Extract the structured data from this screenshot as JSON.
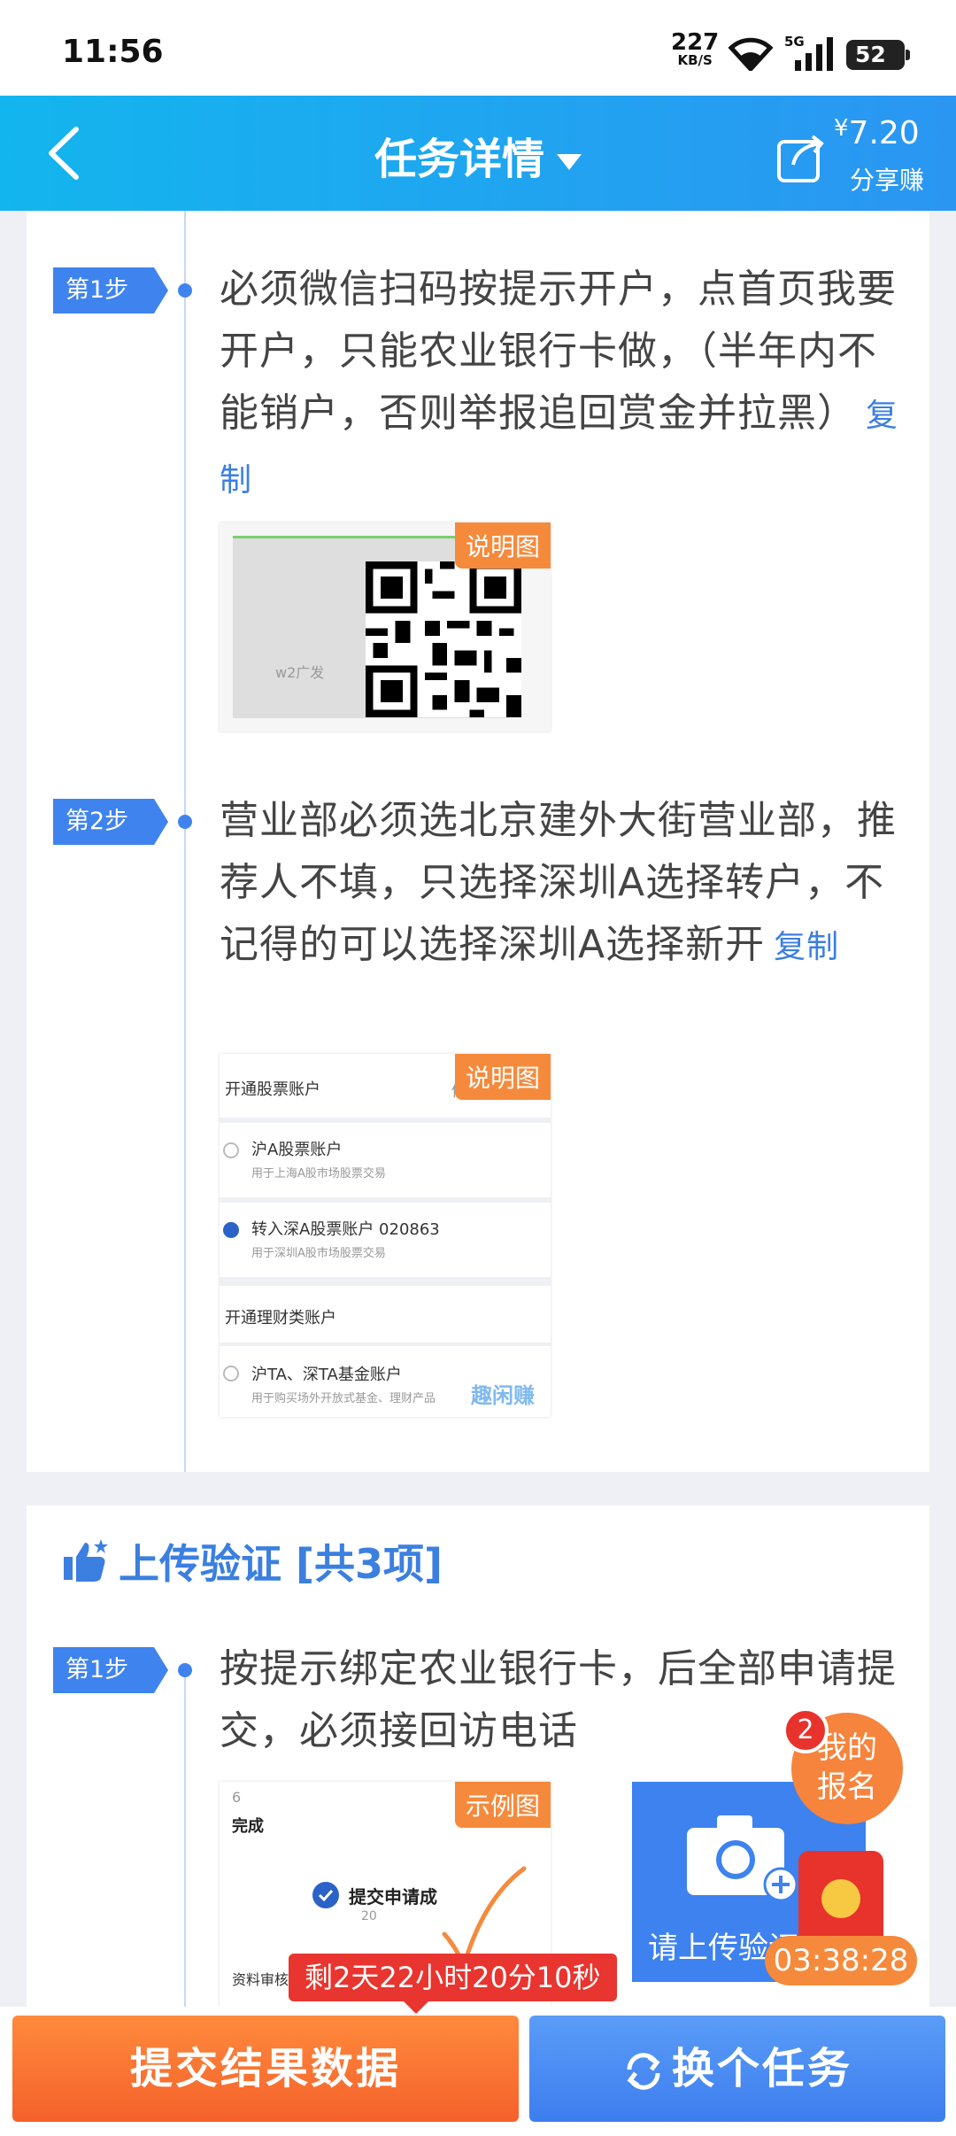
{
  "status_bar": {
    "time": "11:56",
    "net_speed": "227",
    "net_unit": "KB/S",
    "network": "5G",
    "battery": "52"
  },
  "header": {
    "title": "任务详情",
    "price": "7.20",
    "currency": "¥",
    "share_label": "分享赚"
  },
  "steps": [
    {
      "badge": "第1步",
      "text": "必须微信扫码按提示开户，点首页我要开户，只能农业银行卡做，（半年内不能销户，否则举报追回赏金并拉黑）",
      "copy": "复制",
      "image_tag": "说明图",
      "image_caption": "w2广发"
    },
    {
      "badge": "第2步",
      "text": "营业部必须选北京建外大街营业部，推荐人不填，只选择深圳A选择转户，不记得的可以选择深圳A选择新开",
      "copy": "复制",
      "image_tag": "说明图",
      "form": {
        "section1": "开通股票账户",
        "edit": "修",
        "opt1": "沪A股票账户",
        "opt1_sub": "用于上海A股市场股票交易",
        "opt2": "转入深A股票账户 020863",
        "opt2_sub": "用于深圳A股市场股票交易",
        "section2": "开通理财类账户",
        "opt3": "沪TA、深TA基金账户",
        "opt3_sub": "用于购买场外开放式基金、理财产品",
        "watermark": "趣闲赚"
      }
    }
  ],
  "upload": {
    "title": "上传验证 [共3项]",
    "step_badge": "第1步",
    "step_text": "按提示绑定农业银行卡，后全部申请提交，必须接回访电话",
    "example_tag": "示例图",
    "example": {
      "num": "6",
      "done": "完成",
      "submitted": "提交申请成",
      "time": "20",
      "review": "资料审核"
    },
    "upload_label": "请上传验证"
  },
  "float": {
    "badge_count": "2",
    "my_signup": "我的报名",
    "timer": "03:38:28"
  },
  "bottom": {
    "countdown": "剩2天22小时20分10秒",
    "submit": "提交结果数据",
    "switch": "换个任务"
  }
}
